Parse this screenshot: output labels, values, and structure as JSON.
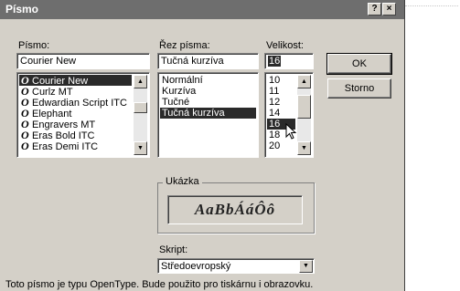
{
  "dialog": {
    "title": "Písmo",
    "help_label": "?",
    "close_label": "×"
  },
  "font": {
    "label": "Písmo:",
    "value": "Courier New",
    "items": [
      {
        "icon": "O",
        "label": "Courier New"
      },
      {
        "icon": "O",
        "label": "Curlz MT"
      },
      {
        "icon": "O",
        "label": "Edwardian Script ITC"
      },
      {
        "icon": "O",
        "label": "Elephant"
      },
      {
        "icon": "O",
        "label": "Engravers MT"
      },
      {
        "icon": "O",
        "label": "Eras Bold ITC"
      },
      {
        "icon": "O",
        "label": "Eras Demi ITC"
      }
    ],
    "selected": "Courier New"
  },
  "style": {
    "label": "Řez písma:",
    "value": "Tučná kurzíva",
    "items": [
      "Normální",
      "Kurzíva",
      "Tučné",
      "Tučná kurzíva"
    ],
    "selected": "Tučná kurzíva"
  },
  "size": {
    "label": "Velikost:",
    "value": "16",
    "items": [
      "10",
      "11",
      "12",
      "14",
      "16",
      "18",
      "20"
    ],
    "selected": "16"
  },
  "buttons": {
    "ok": "OK",
    "cancel": "Storno"
  },
  "sample": {
    "label": "Ukázka",
    "text": "AaBbÁáÔô"
  },
  "script": {
    "label": "Skript:",
    "value": "Středoevropský"
  },
  "info_text": "Toto písmo je typu OpenType. Bude použito pro tiskárnu i obrazovku."
}
